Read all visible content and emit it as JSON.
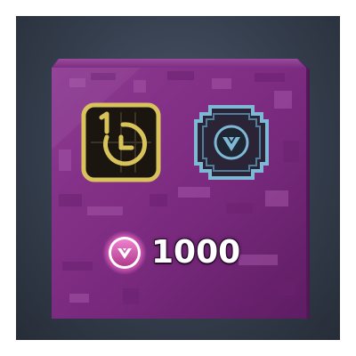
{
  "reward": {
    "amount": "1000"
  },
  "icons": {
    "timer": "boost-timer-icon",
    "emblem": "v-emblem-badge-icon",
    "coin": "v-coin-icon"
  },
  "colors": {
    "box_purple": "#7a2a7c",
    "timer_gold": "#d8c25a",
    "emblem_blue": "#7fb8d4",
    "coin_pink": "#e04fb0"
  }
}
